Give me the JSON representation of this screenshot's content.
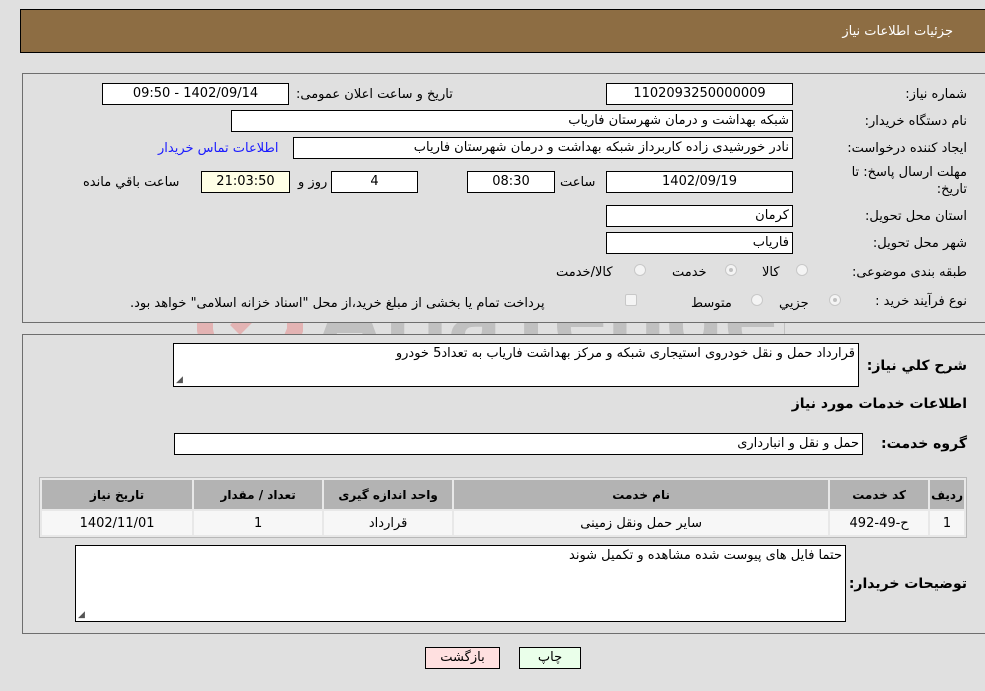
{
  "header": {
    "title": "جزئیات اطلاعات نیاز"
  },
  "form": {
    "need_number": {
      "label": "شماره نیاز:",
      "value": "1102093250000009"
    },
    "announce_datetime": {
      "label": "تاریخ و ساعت اعلان عمومی:",
      "value": "1402/09/14 - 09:50"
    },
    "buyer_org": {
      "label": "نام دستگاه خریدار:",
      "value": "شبکه بهداشت و درمان شهرستان فاریاب"
    },
    "requester": {
      "label": "ایجاد کننده درخواست:",
      "value": "نادر خورشیدی زاده کاربرداز شبکه بهداشت و درمان شهرستان فاریاب"
    },
    "buyer_contact_link": "اطلاعات تماس خریدار",
    "deadline": {
      "label_line1": "مهلت ارسال پاسخ: تا",
      "label_line2": "تاریخ:",
      "date": "1402/09/19",
      "time_label": "ساعت",
      "time": "08:30",
      "days": "4",
      "days_label": "روز و",
      "remaining": "21:03:50",
      "remaining_label": "ساعت باقي مانده"
    },
    "province": {
      "label": "استان محل تحویل:",
      "value": "کرمان"
    },
    "city": {
      "label": "شهر محل تحویل:",
      "value": "فاریاب"
    },
    "category": {
      "label": "طبقه بندی موضوعی:",
      "options": [
        "کالا",
        "خدمت",
        "کالا/خدمت"
      ],
      "selected": "خدمت"
    },
    "purchase_type": {
      "label": "نوع فرآیند خرید :",
      "options": [
        "جزيي",
        "متوسط"
      ],
      "selected": "جزيي",
      "treasury_note": "پرداخت تمام یا بخشی از مبلغ خرید،از محل \"اسناد خزانه اسلامی\" خواهد بود."
    }
  },
  "details": {
    "description_label": "شرح کلي نیاز:",
    "description": "قرارداد حمل و نقل خودروی استیجاری شبکه و مرکز بهداشت فاریاب به تعداد5 خودرو",
    "services_heading": "اطلاعات خدمات مورد نیاز",
    "service_group_label": "گروه خدمت:",
    "service_group": "حمل و نقل و انبارداری",
    "table": {
      "headers": [
        "ردیف",
        "کد خدمت",
        "نام خدمت",
        "واحد اندازه گیری",
        "تعداد / مقدار",
        "تاریخ نیاز"
      ],
      "rows": [
        [
          "1",
          "ح-49-492",
          "سایر حمل ونقل زمینی",
          "قرارداد",
          "1",
          "1402/11/01"
        ]
      ]
    },
    "buyer_notes_label": "توضیحات خریدار:",
    "buyer_notes": "حتما فایل های پیوست شده مشاهده و تکمیل شوند"
  },
  "buttons": {
    "print": "چاپ",
    "back": "بازگشت"
  },
  "colors": {
    "header_bg": "#8d6d43",
    "print_bg": "#eaffea",
    "back_bg": "#ffe0e0",
    "link": "#1a1aff"
  },
  "watermark": "AriaTender.net"
}
